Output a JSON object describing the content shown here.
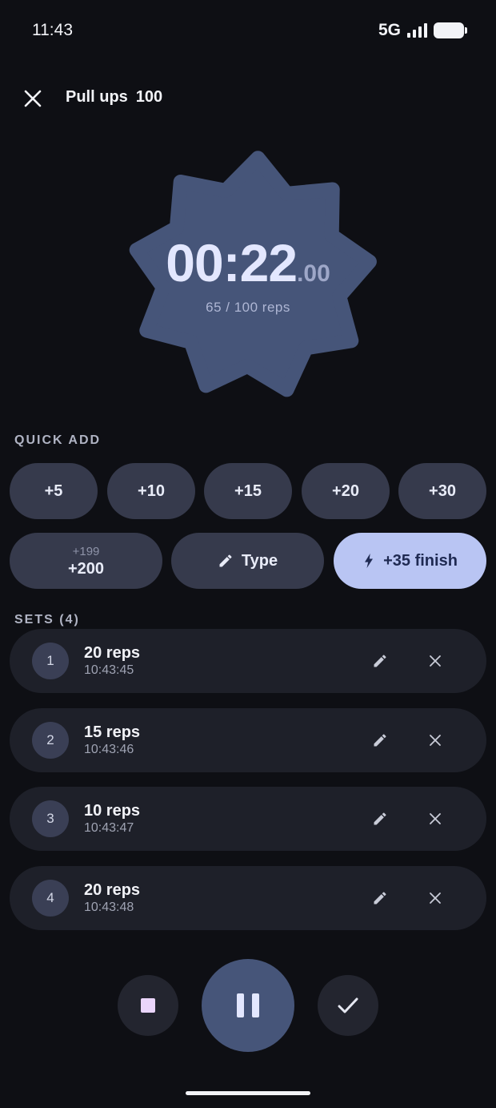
{
  "status_bar": {
    "time": "11:43",
    "network": "5G"
  },
  "header": {
    "exercise": "Pull ups",
    "target": "100"
  },
  "timer": {
    "main": "00:22",
    "fraction": ".00",
    "progress_text": "65 / 100 reps",
    "reps_done": 65,
    "reps_target": 100
  },
  "quick_add": {
    "label": "QUICK ADD",
    "row1": [
      "+5",
      "+10",
      "+15",
      "+20",
      "+30"
    ],
    "big_add": {
      "label": "+200",
      "sub": "+199"
    },
    "type_label": "Type",
    "finish_label": "+35 finish"
  },
  "sets": {
    "label": "SETS (4)",
    "items": [
      {
        "num": "1",
        "reps": "20 reps",
        "time": "10:43:45"
      },
      {
        "num": "2",
        "reps": "15 reps",
        "time": "10:43:46"
      },
      {
        "num": "3",
        "reps": "10 reps",
        "time": "10:43:47"
      },
      {
        "num": "4",
        "reps": "20 reps",
        "time": "10:43:48"
      }
    ]
  },
  "colors": {
    "background": "#0e0f14",
    "badge": "#465579",
    "accent": "#b9c5f3",
    "card": "#1e2029",
    "pill": "#363a4c"
  },
  "icons": {
    "close": "close-icon",
    "edit": "pencil-icon",
    "delete": "close-icon",
    "stop": "stop-icon",
    "pause": "pause-icon",
    "finish": "check-icon",
    "bolt": "bolt-icon"
  }
}
